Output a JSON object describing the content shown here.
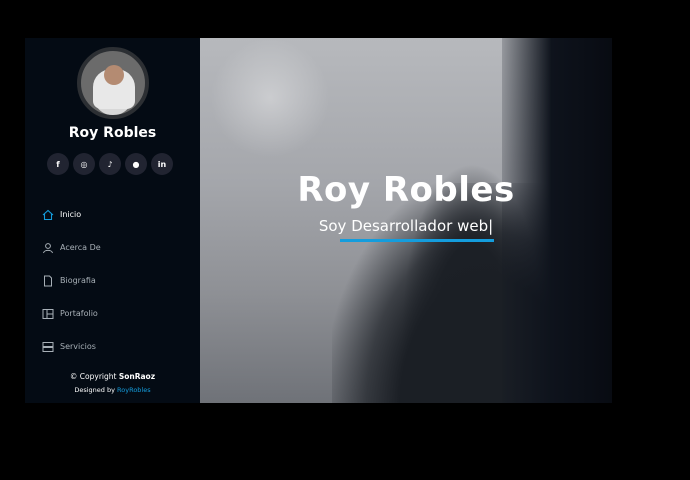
{
  "sidebar": {
    "name": "Roy Robles",
    "socials": [
      {
        "icon": "facebook-icon",
        "glyph": "f"
      },
      {
        "icon": "instagram-icon",
        "glyph": "◎"
      },
      {
        "icon": "tiktok-icon",
        "glyph": "♪"
      },
      {
        "icon": "github-icon",
        "glyph": "●"
      },
      {
        "icon": "linkedin-icon",
        "glyph": "in"
      }
    ],
    "nav": [
      {
        "label": "Inicio",
        "icon": "home-icon",
        "active": true
      },
      {
        "label": "Acerca De",
        "icon": "user-icon",
        "active": false
      },
      {
        "label": "Biografia",
        "icon": "file-icon",
        "active": false
      },
      {
        "label": "Portafolio",
        "icon": "portfolio-icon",
        "active": false
      },
      {
        "label": "Servicios",
        "icon": "server-icon",
        "active": false
      }
    ],
    "footer": {
      "copyright_prefix": "© Copyright ",
      "copyright_brand": "SonRaoz",
      "designed_prefix": "Designed by ",
      "designed_link": "RoyRobles"
    }
  },
  "hero": {
    "title": "Roy Robles",
    "subtitle": "Soy Desarrollador web|"
  },
  "colors": {
    "accent": "#149ddd",
    "sidebar_bg": "#040b14"
  }
}
